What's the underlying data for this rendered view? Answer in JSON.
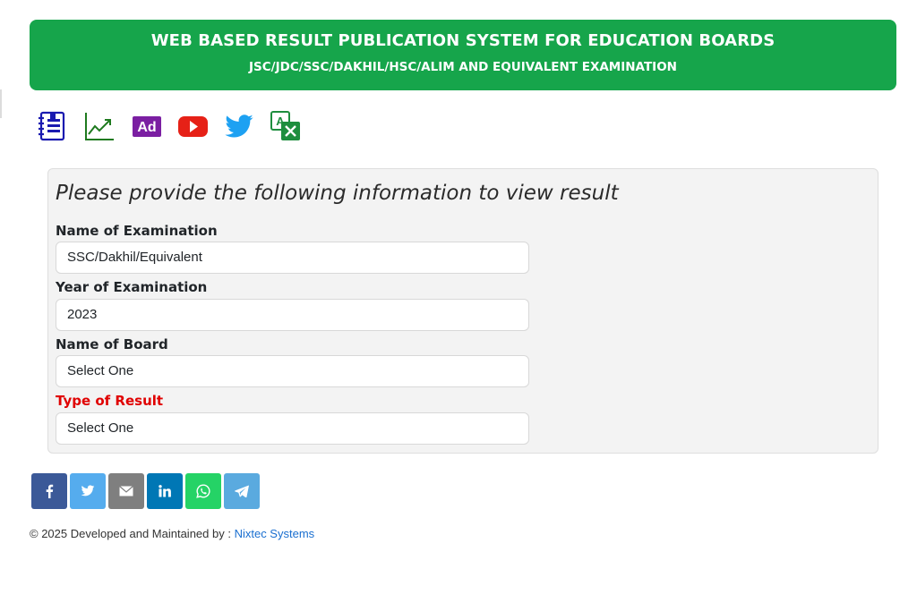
{
  "header": {
    "title": "WEB BASED RESULT PUBLICATION SYSTEM FOR EDUCATION BOARDS",
    "subtitle": "JSC/JDC/SSC/DAKHIL/HSC/ALIM AND EQUIVALENT EXAMINATION",
    "color": "#16a54b"
  },
  "toolbar_icons": [
    {
      "name": "notebook-icon",
      "color": "#1a1ab0"
    },
    {
      "name": "trend-chart-icon",
      "color": "#1f7a1f"
    },
    {
      "name": "ad-icon",
      "label": "Ad",
      "color": "#7b1fa2"
    },
    {
      "name": "youtube-icon",
      "color": "#e62117"
    },
    {
      "name": "twitter-icon",
      "color": "#1da1f2"
    },
    {
      "name": "translate-icon",
      "color": "#1e8e3e"
    }
  ],
  "form": {
    "heading": "Please provide the following information to view result",
    "fields": [
      {
        "label": "Name of Examination",
        "value": "SSC/Dakhil/Equivalent"
      },
      {
        "label": "Year of Examination",
        "value": "2023"
      },
      {
        "label": "Name of Board",
        "value": "Select One"
      },
      {
        "label": "Type of Result",
        "value": "Select One",
        "label_color": "#e00000"
      }
    ]
  },
  "share_buttons": [
    {
      "name": "facebook-share-button",
      "icon": "facebook-icon",
      "color": "#3b5998"
    },
    {
      "name": "twitter-share-button",
      "icon": "twitter-icon",
      "color": "#55acee"
    },
    {
      "name": "email-share-button",
      "icon": "envelope-icon",
      "color": "#7f7f7f"
    },
    {
      "name": "linkedin-share-button",
      "icon": "linkedin-icon",
      "color": "#0077b5"
    },
    {
      "name": "whatsapp-share-button",
      "icon": "whatsapp-icon",
      "color": "#25d366"
    },
    {
      "name": "telegram-share-button",
      "icon": "telegram-icon",
      "color": "#5aaadf"
    }
  ],
  "footer": {
    "text": "© 2025 Developed and Maintained by : ",
    "link": "Nixtec Systems"
  }
}
